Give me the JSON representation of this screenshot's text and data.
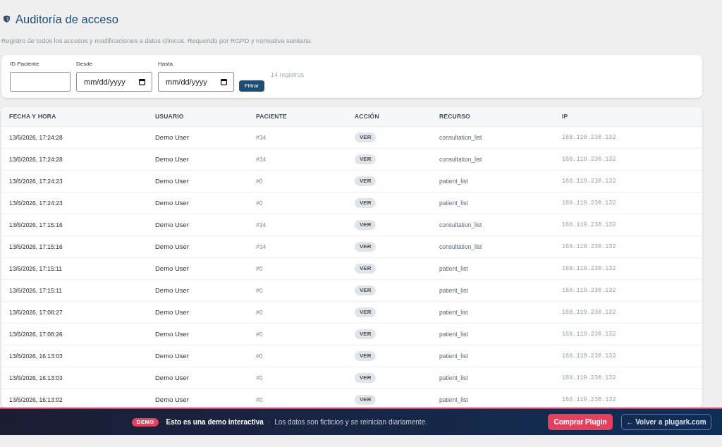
{
  "page": {
    "title": "Auditoría de acceso",
    "subtitle": "Registro de todos los accesos y modificaciones a datos clínicos. Requerido por RGPD y normativa sanitaria."
  },
  "filters": {
    "fields": [
      {
        "label": "ID Paciente",
        "kind": "text"
      },
      {
        "label": "Desde",
        "kind": "date",
        "placeholder": "mm/dd/yyyy"
      },
      {
        "label": "Hasta",
        "kind": "date",
        "placeholder": "mm/dd/yyyy"
      }
    ],
    "button": "Filtrar",
    "count": "14 registros"
  },
  "table": {
    "columns": [
      "FECHA Y HORA",
      "USUARIO",
      "PACIENTE",
      "ACCIÓN",
      "RECURSO",
      "IP"
    ],
    "rows": [
      {
        "date_time": "13/6/2026, 17:24:28",
        "user": "Demo User",
        "patient": "#34",
        "action": "VER",
        "resource": "consultation_list",
        "ip": "168.119.230.132"
      },
      {
        "date_time": "13/6/2026, 17:24:28",
        "user": "Demo User",
        "patient": "#34",
        "action": "VER",
        "resource": "consultation_list",
        "ip": "168.119.230.132"
      },
      {
        "date_time": "13/6/2026, 17:24:23",
        "user": "Demo User",
        "patient": "#0",
        "action": "VER",
        "resource": "patient_list",
        "ip": "168.119.230.132"
      },
      {
        "date_time": "13/6/2026, 17:24:23",
        "user": "Demo User",
        "patient": "#0",
        "action": "VER",
        "resource": "patient_list",
        "ip": "168.119.230.132"
      },
      {
        "date_time": "13/6/2026, 17:15:16",
        "user": "Demo User",
        "patient": "#34",
        "action": "VER",
        "resource": "consultation_list",
        "ip": "168.119.230.132"
      },
      {
        "date_time": "13/6/2026, 17:15:16",
        "user": "Demo User",
        "patient": "#34",
        "action": "VER",
        "resource": "consultation_list",
        "ip": "168.119.230.132"
      },
      {
        "date_time": "13/6/2026, 17:15:11",
        "user": "Demo User",
        "patient": "#0",
        "action": "VER",
        "resource": "patient_list",
        "ip": "168.119.230.132"
      },
      {
        "date_time": "13/6/2026, 17:15:11",
        "user": "Demo User",
        "patient": "#0",
        "action": "VER",
        "resource": "patient_list",
        "ip": "168.119.230.132"
      },
      {
        "date_time": "13/6/2026, 17:08:27",
        "user": "Demo User",
        "patient": "#0",
        "action": "VER",
        "resource": "patient_list",
        "ip": "168.119.230.132"
      },
      {
        "date_time": "13/6/2026, 17:08:26",
        "user": "Demo User",
        "patient": "#0",
        "action": "VER",
        "resource": "patient_list",
        "ip": "168.119.230.132"
      },
      {
        "date_time": "13/6/2026, 16:13:03",
        "user": "Demo User",
        "patient": "#0",
        "action": "VER",
        "resource": "patient_list",
        "ip": "168.119.230.132"
      },
      {
        "date_time": "13/6/2026, 16:13:03",
        "user": "Demo User",
        "patient": "#0",
        "action": "VER",
        "resource": "patient_list",
        "ip": "168.119.230.132"
      },
      {
        "date_time": "13/6/2026, 16:13:02",
        "user": "Demo User",
        "patient": "#0",
        "action": "VER",
        "resource": "patient_list",
        "ip": "168.119.230.132"
      }
    ]
  },
  "demo_banner": {
    "badge": "DEMO",
    "title": "Esto es una demo interactiva",
    "separator": "·",
    "message": "Los datos son ficticios y se reinician diariamente.",
    "buttons": [
      {
        "label": "Comprar Plugin",
        "kind": "primary"
      },
      {
        "label": "← Volver a plugark.com",
        "kind": "outline"
      }
    ]
  }
}
